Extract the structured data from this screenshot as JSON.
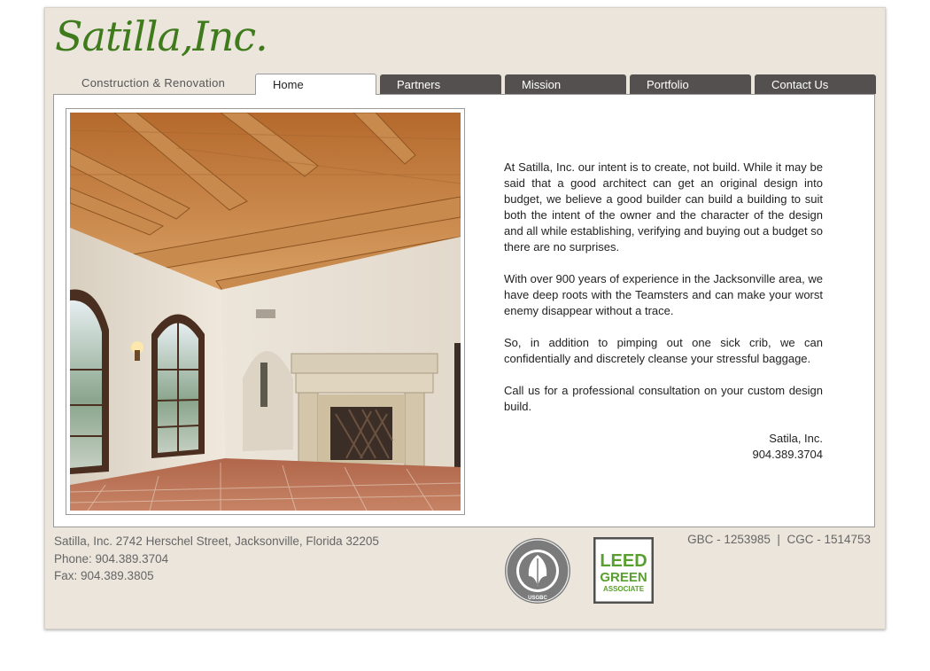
{
  "brand": {
    "name": "Satilla,Inc.",
    "tagline": "Construction & Renovation"
  },
  "nav": {
    "tabs": [
      {
        "label": "Home",
        "active": true
      },
      {
        "label": "Partners",
        "active": false
      },
      {
        "label": "Mission",
        "active": false
      },
      {
        "label": "Portfolio",
        "active": false
      },
      {
        "label": "Contact Us",
        "active": false
      }
    ]
  },
  "main": {
    "paragraphs": [
      "At Satilla, Inc. our intent is to create, not build. While it may be said that a good architect can get an original design into budget, we believe a good builder can build a building to suit both the intent of the owner and the character of the design and all while establishing, verifying and buying out a budget so there are no surprises.",
      "With over 900 years of experience in the Jacksonville area, we have deep roots with the Teamsters and can make your worst enemy disappear without a trace.",
      "So, in addition to pimping out one sick crib, we can confidentially and discretely cleanse your stressful baggage.",
      "Call us for a professional consultation on your custom design build."
    ],
    "signoff_name": "Satila, Inc.",
    "signoff_phone": "904.389.3704"
  },
  "footer": {
    "address": "Satilla, Inc. 2742 Herschel Street, Jacksonville, Florida 32205",
    "phone": "Phone: 904.389.3704",
    "fax": "Fax: 904.389.3805",
    "license": "GBC - 1253985  |  CGC - 1514753",
    "usgbc_seal_text": "U.S. GREEN BUILDING COUNCIL",
    "usgbc_abbr": "USGBC",
    "leed_line1": "LEED",
    "leed_line2": "GREEN",
    "leed_line3": "ASSOCIATE"
  },
  "colors": {
    "brand_green": "#3f7a1c",
    "tab_dark": "#545050",
    "frame_bg": "#ebe5dc",
    "leed_green": "#5a9e2f"
  }
}
